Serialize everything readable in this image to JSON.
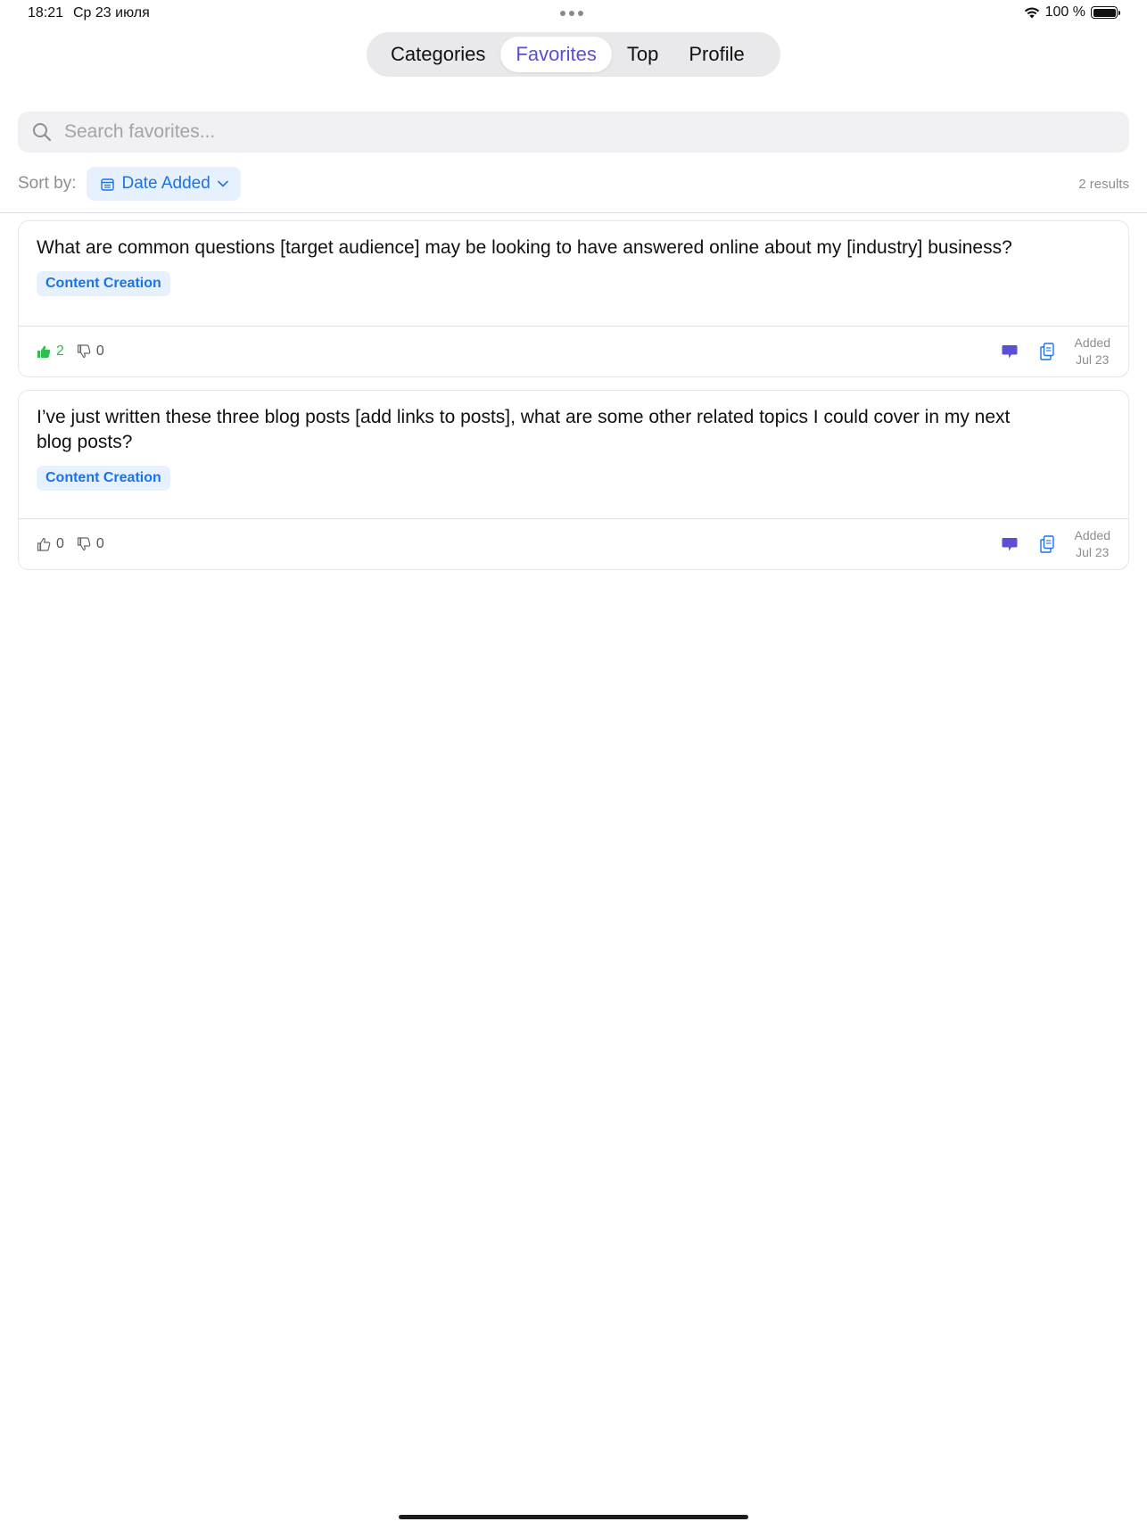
{
  "status_bar": {
    "time": "18:21",
    "date": "Ср 23 июля",
    "battery": "100 %"
  },
  "tabs": [
    {
      "label": "Categories",
      "active": false
    },
    {
      "label": "Favorites",
      "active": true
    },
    {
      "label": "Top",
      "active": false
    },
    {
      "label": "Profile",
      "active": false
    }
  ],
  "search": {
    "placeholder": "Search favorites...",
    "value": ""
  },
  "sort": {
    "label": "Sort by:",
    "selected": "Date Added",
    "results": "2 results"
  },
  "cards": [
    {
      "text": "What are common questions [target audience] may be looking to have answered online about my [industry] business?",
      "tag": "Content Creation",
      "likes": "2",
      "dislikes": "0",
      "liked": true,
      "added_label": "Added",
      "added_date": "Jul 23"
    },
    {
      "text": "I’ve just written these three blog posts [add links to posts], what are some other related topics I could cover in my next blog posts?",
      "tag": "Content Creation",
      "likes": "0",
      "dislikes": "0",
      "liked": false,
      "added_label": "Added",
      "added_date": "Jul 23"
    }
  ],
  "colors": {
    "accent": "#5b4fd6",
    "link_blue": "#1a73e8",
    "like_green": "#2fbf4f"
  }
}
